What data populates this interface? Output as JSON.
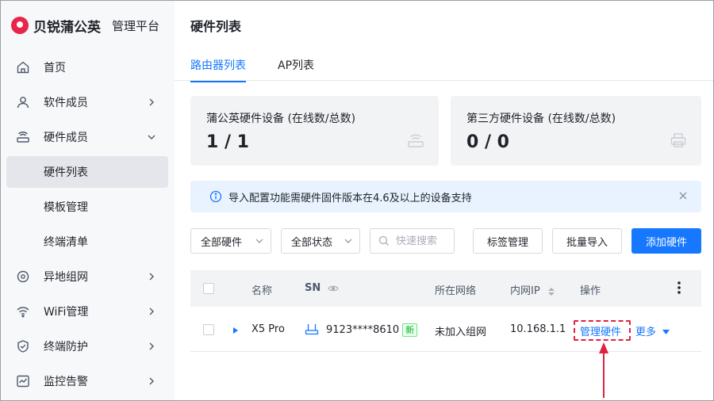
{
  "sidebar": {
    "brand": "贝锐蒲公英",
    "platform": "管理平台",
    "items": [
      {
        "label": "首页"
      },
      {
        "label": "软件成员"
      },
      {
        "label": "硬件成员"
      },
      {
        "label": "硬件列表"
      },
      {
        "label": "模板管理"
      },
      {
        "label": "终端清单"
      },
      {
        "label": "异地组网"
      },
      {
        "label": "WiFi管理"
      },
      {
        "label": "终端防护"
      },
      {
        "label": "监控告警"
      }
    ]
  },
  "page": {
    "title": "硬件列表",
    "tabs": [
      {
        "label": "路由器列表"
      },
      {
        "label": "AP列表"
      }
    ]
  },
  "stats": [
    {
      "title": "蒲公英硬件设备 (在线数/总数)",
      "value": "1 / 1"
    },
    {
      "title": "第三方硬件设备 (在线数/总数)",
      "value": "0 / 0"
    }
  ],
  "notice": {
    "text": "导入配置功能需硬件固件版本在4.6及以上的设备支持"
  },
  "toolbar": {
    "filter_hardware": "全部硬件",
    "filter_status": "全部状态",
    "search_placeholder": "快速搜索",
    "tag_button": "标签管理",
    "import_button": "批量导入",
    "add_button": "添加硬件"
  },
  "table": {
    "headers": {
      "name": "名称",
      "sn": "SN",
      "network": "所在网络",
      "ip": "内网IP",
      "action": "操作"
    },
    "rows": [
      {
        "name": "X5 Pro",
        "sn": "9123****8610",
        "badge": "新",
        "network": "未加入组网",
        "ip": "10.168.1.1",
        "manage": "管理硬件",
        "more": "更多"
      }
    ]
  },
  "colors": {
    "accent": "#1677ff",
    "highlight": "#e0213f",
    "brand": "#e8254a"
  }
}
